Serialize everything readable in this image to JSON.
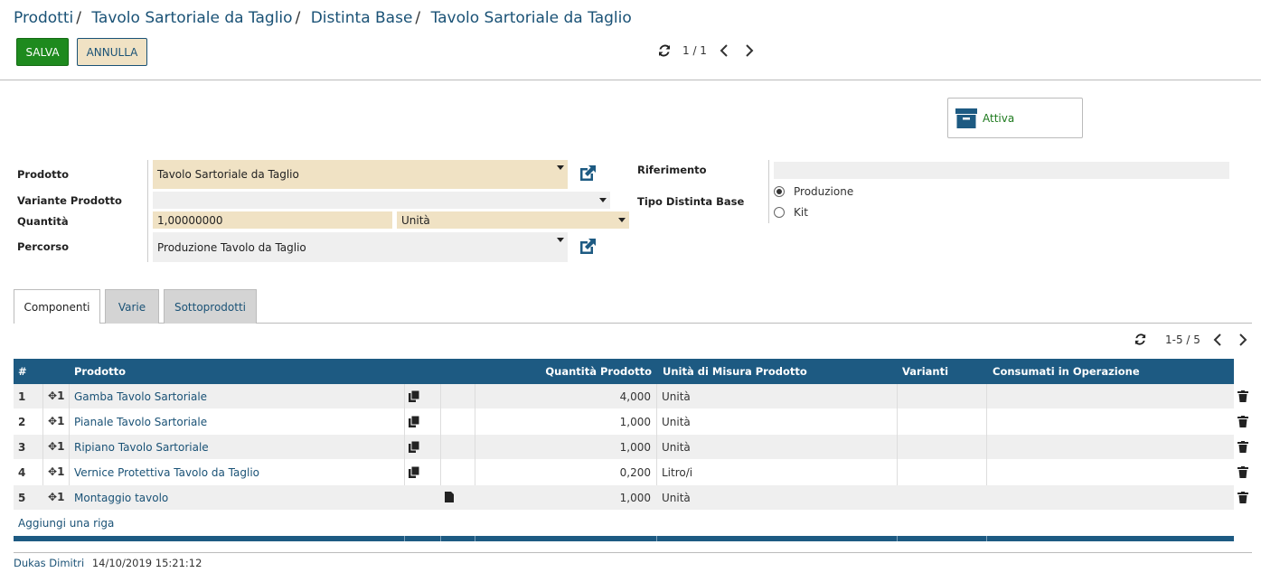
{
  "breadcrumb": [
    "Prodotti",
    "Tavolo Sartoriale da Taglio",
    "Distinta Base",
    "Tavolo Sartoriale da Taglio"
  ],
  "buttons": {
    "save": "SALVA",
    "cancel": "ANNULLA"
  },
  "pager": {
    "record": "1 / 1"
  },
  "status": {
    "label": "Attiva"
  },
  "form": {
    "prodotto": {
      "label": "Prodotto",
      "value": "Tavolo Sartoriale da Taglio"
    },
    "variante": {
      "label": "Variante Prodotto",
      "value": ""
    },
    "quantita": {
      "label": "Quantità",
      "value": "1,00000000",
      "uom": "Unità"
    },
    "percorso": {
      "label": "Percorso",
      "value": "Produzione Tavolo da Taglio"
    },
    "riferimento": {
      "label": "Riferimento",
      "value": ""
    },
    "tipo": {
      "label": "Tipo Distinta Base",
      "options": [
        "Produzione",
        "Kit"
      ],
      "selected": "Produzione"
    }
  },
  "tabs": [
    "Componenti",
    "Varie",
    "Sottoprodotti"
  ],
  "grid": {
    "pager": "1-5 / 5",
    "headers": {
      "num": "#",
      "prodotto": "Prodotto",
      "quantita": "Quantità Prodotto",
      "uom": "Unità di Misura Prodotto",
      "varianti": "Varianti",
      "consumati": "Consumati in Operazione"
    },
    "rows": [
      {
        "num": "1",
        "drag": "1",
        "prodotto": "Gamba Tavolo Sartoriale",
        "quantita": "4,000",
        "uom": "Unità"
      },
      {
        "num": "2",
        "drag": "1",
        "prodotto": "Pianale Tavolo Sartoriale",
        "quantita": "1,000",
        "uom": "Unità"
      },
      {
        "num": "3",
        "drag": "1",
        "prodotto": "Ripiano Tavolo Sartoriale",
        "quantita": "1,000",
        "uom": "Unità"
      },
      {
        "num": "4",
        "drag": "1",
        "prodotto": "Vernice Protettiva Tavolo da Taglio",
        "quantita": "0,200",
        "uom": "Litro/i"
      },
      {
        "num": "5",
        "drag": "1",
        "prodotto": "Montaggio tavolo",
        "quantita": "1,000",
        "uom": "Unità"
      }
    ],
    "add_row": "Aggiungi una riga"
  },
  "footer": {
    "user": "Dukas Dimitri",
    "timestamp": "14/10/2019 15:21:12"
  },
  "colors": {
    "accent": "#1d5a82",
    "save": "#1e8a1e",
    "required_bg": "#f0e2c4",
    "link": "#1a5276"
  }
}
